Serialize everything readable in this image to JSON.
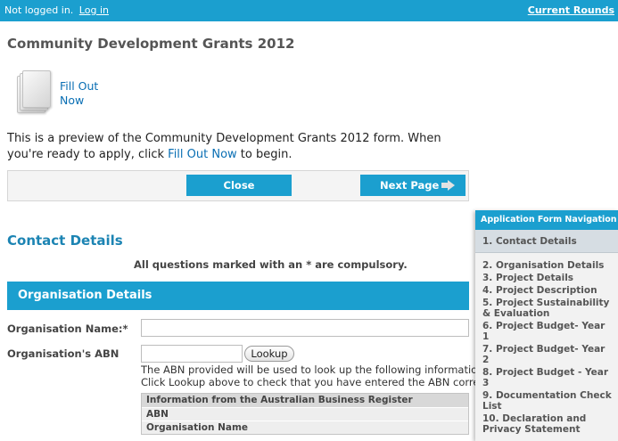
{
  "topbar": {
    "status_text": "Not logged in.",
    "login_link": "Log in",
    "current_rounds_link": "Current Rounds"
  },
  "page": {
    "title": "Community Development Grants 2012",
    "fill_out_now": "Fill Out Now",
    "intro_before": "This is a preview of the Community Development Grants 2012 form. When you're ready to apply, click ",
    "intro_link": "Fill Out Now",
    "intro_after": " to begin."
  },
  "buttons": {
    "close": "Close",
    "next_page": "Next Page"
  },
  "section": {
    "title": "Contact Details",
    "compulsory_note": "All questions marked with an * are compulsory."
  },
  "org": {
    "header": "Organisation Details",
    "name_label": "Organisation Name:*",
    "name_value": "",
    "abn_label": "Organisation's ABN",
    "abn_value": "",
    "lookup_button": "Lookup",
    "help_line1": "The ABN provided will be used to look up the following information.",
    "help_line2": "Click Lookup above to check that you have entered the ABN correctly.",
    "abr_rows": [
      "Information from the Australian Business Register",
      "ABN",
      "Organisation Name"
    ]
  },
  "nav": {
    "header": "Application Form Navigation",
    "items": [
      "1. Contact Details",
      "2. Organisation Details",
      "3. Project Details",
      "4. Project Description",
      "5. Project Sustainability & Evaluation",
      "6. Project Budget- Year 1",
      "7. Project Budget- Year 2",
      "8. Project Budget - Year 3",
      "9. Documentation Check List",
      "10. Declaration and Privacy Statement"
    ],
    "active_index": 0
  },
  "colors": {
    "accent": "#1b9fcf",
    "link": "#0a6fb4",
    "heading_blue": "#1c84b3"
  },
  "icons": {
    "form_document": "document-stack-icon",
    "next_arrow": "arrow-right-icon"
  }
}
